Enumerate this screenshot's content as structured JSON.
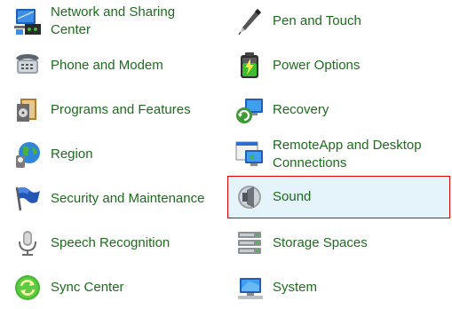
{
  "items": [
    {
      "label": "Network and Sharing Center",
      "icon": "network-icon"
    },
    {
      "label": "Pen and Touch",
      "icon": "pen-icon"
    },
    {
      "label": "Phone and Modem",
      "icon": "phone-modem-icon"
    },
    {
      "label": "Power Options",
      "icon": "battery-icon"
    },
    {
      "label": "Programs and Features",
      "icon": "programs-icon"
    },
    {
      "label": "Recovery",
      "icon": "recovery-icon"
    },
    {
      "label": "Region",
      "icon": "globe-icon"
    },
    {
      "label": "RemoteApp and Desktop Connections",
      "icon": "remote-desktop-icon"
    },
    {
      "label": "Security and Maintenance",
      "icon": "flag-icon"
    },
    {
      "label": "Sound",
      "icon": "speaker-icon",
      "selected": true
    },
    {
      "label": "Speech Recognition",
      "icon": "microphone-icon"
    },
    {
      "label": "Storage Spaces",
      "icon": "storage-icon"
    },
    {
      "label": "Sync Center",
      "icon": "sync-icon"
    },
    {
      "label": "System",
      "icon": "computer-icon"
    }
  ],
  "colors": {
    "link_text": "#1e6b1e",
    "selected_background": "#e5f3fb",
    "selected_border": "#e00000"
  }
}
